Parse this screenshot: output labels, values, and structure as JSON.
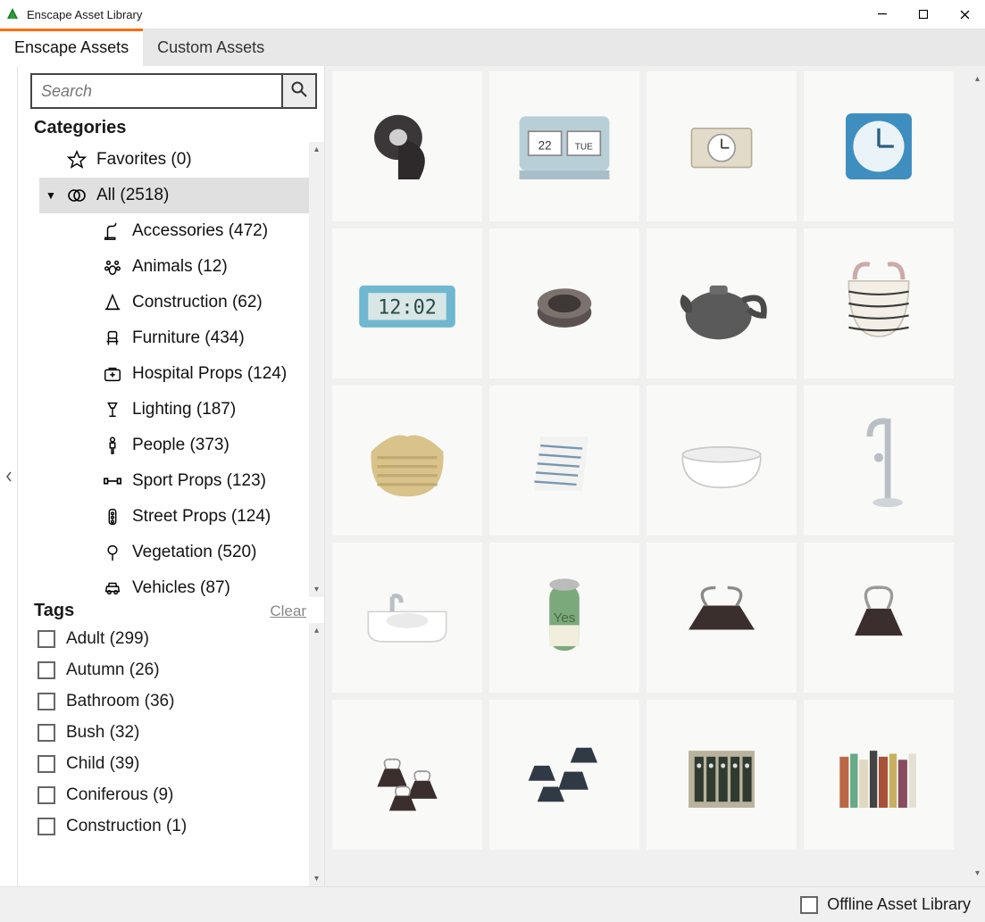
{
  "window": {
    "title": "Enscape Asset Library"
  },
  "tabs": [
    {
      "label": "Enscape Assets",
      "active": true
    },
    {
      "label": "Custom Assets",
      "active": false
    }
  ],
  "search": {
    "placeholder": "Search",
    "value": ""
  },
  "categories_label": "Categories",
  "categories": {
    "favorites": {
      "label": "Favorites",
      "count": 0
    },
    "all": {
      "label": "All",
      "count": 2518
    },
    "children": [
      {
        "key": "accessories",
        "label": "Accessories",
        "count": 472
      },
      {
        "key": "animals",
        "label": "Animals",
        "count": 12
      },
      {
        "key": "construction",
        "label": "Construction",
        "count": 62
      },
      {
        "key": "furniture",
        "label": "Furniture",
        "count": 434
      },
      {
        "key": "hospital",
        "label": "Hospital Props",
        "count": 124
      },
      {
        "key": "lighting",
        "label": "Lighting",
        "count": 187
      },
      {
        "key": "people",
        "label": "People",
        "count": 373
      },
      {
        "key": "sport",
        "label": "Sport Props",
        "count": 123
      },
      {
        "key": "street",
        "label": "Street Props",
        "count": 124
      },
      {
        "key": "vegetation",
        "label": "Vegetation",
        "count": 520
      },
      {
        "key": "vehicles",
        "label": "Vehicles",
        "count": 87
      }
    ]
  },
  "tags_label": "Tags",
  "tags_clear": "Clear",
  "tags": [
    {
      "label": "Adult",
      "count": 299,
      "checked": false
    },
    {
      "label": "Autumn",
      "count": 26,
      "checked": false
    },
    {
      "label": "Bathroom",
      "count": 36,
      "checked": false
    },
    {
      "label": "Bush",
      "count": 32,
      "checked": false
    },
    {
      "label": "Child",
      "count": 39,
      "checked": false
    },
    {
      "label": "Coniferous",
      "count": 9,
      "checked": false
    },
    {
      "label": "Construction",
      "count": 1,
      "checked": false
    }
  ],
  "assets": [
    {
      "name": "Adhesive Tape"
    },
    {
      "name": "Alarm Clock Flip"
    },
    {
      "name": "Alarm Clock Rect"
    },
    {
      "name": "Alarm Clock Blue"
    },
    {
      "name": "Alarm Clock Digital"
    },
    {
      "name": "Ashtray"
    },
    {
      "name": "Tea Kettle"
    },
    {
      "name": "Basket Wave"
    },
    {
      "name": "Basket Woven"
    },
    {
      "name": "Bath Towel"
    },
    {
      "name": "Bathtub"
    },
    {
      "name": "Bath Faucet"
    },
    {
      "name": "Bathroom Sink"
    },
    {
      "name": "Beverage Can"
    },
    {
      "name": "Binder Clip Large"
    },
    {
      "name": "Binder Clip"
    },
    {
      "name": "Binder Clips"
    },
    {
      "name": "Binder Clips Large"
    },
    {
      "name": "Binders"
    },
    {
      "name": "Book Row"
    }
  ],
  "status": {
    "offline_label": "Offline Asset Library",
    "offline_checked": false
  }
}
